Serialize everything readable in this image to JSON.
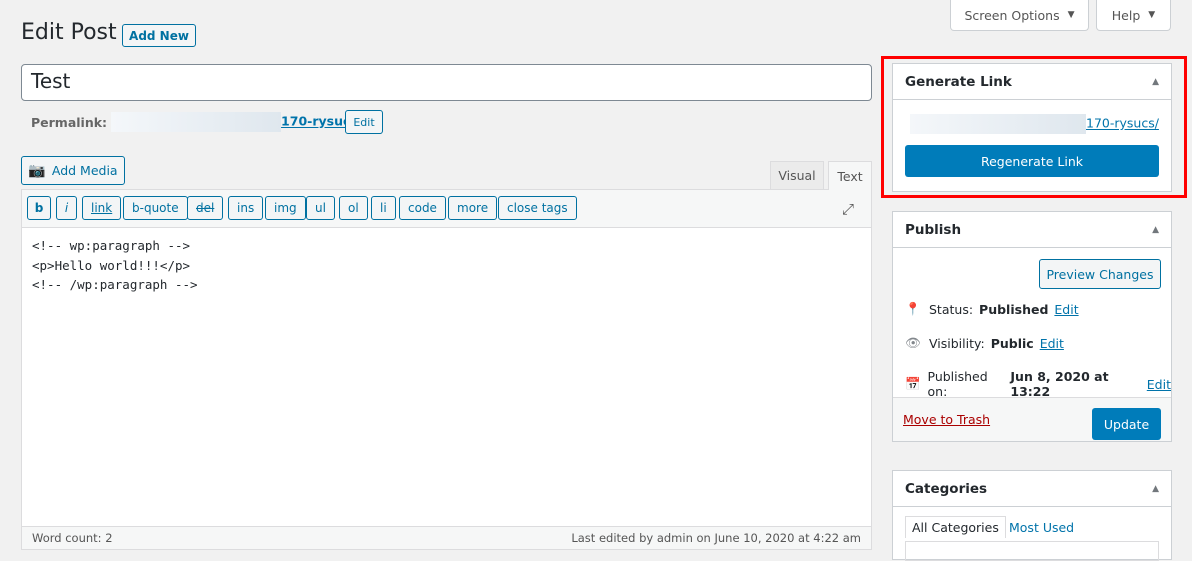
{
  "header": {
    "title": "Edit Post",
    "add_new": "Add New",
    "screen_options": "Screen Options",
    "help": "Help"
  },
  "post": {
    "title": "Test",
    "permalink_label": "Permalink:",
    "permalink_suffix": "170-rysucs/",
    "permalink_edit": "Edit"
  },
  "editor": {
    "add_media": "Add Media",
    "tabs": [
      "Visual",
      "Text"
    ],
    "active_tab": "Text",
    "quicktags": [
      "b",
      "i",
      "link",
      "b-quote",
      "del",
      "ins",
      "img",
      "ul",
      "ol",
      "li",
      "code",
      "more",
      "close tags"
    ],
    "content_lines": [
      "<!-- wp:paragraph -->",
      "<p>Hello world!!!</p>",
      "<!-- /wp:paragraph -->"
    ],
    "word_count": "Word count: 2",
    "last_edited": "Last edited by admin on June 10, 2020 at 4:22 am"
  },
  "generate_link": {
    "title": "Generate Link",
    "link_suffix": "170-rysucs/",
    "regenerate": "Regenerate Link"
  },
  "publish": {
    "title": "Publish",
    "preview": "Preview Changes",
    "status_label": "Status:",
    "status_value": "Published",
    "visibility_label": "Visibility:",
    "visibility_value": "Public",
    "published_label": "Published on:",
    "published_value": "Jun 8, 2020 at 13:22",
    "edit": "Edit",
    "trash": "Move to Trash",
    "update": "Update"
  },
  "categories": {
    "title": "Categories",
    "tabs": [
      "All Categories",
      "Most Used"
    ]
  },
  "colors": {
    "primary": "#007cba",
    "highlight": "#ff0000",
    "trash": "#a00"
  }
}
